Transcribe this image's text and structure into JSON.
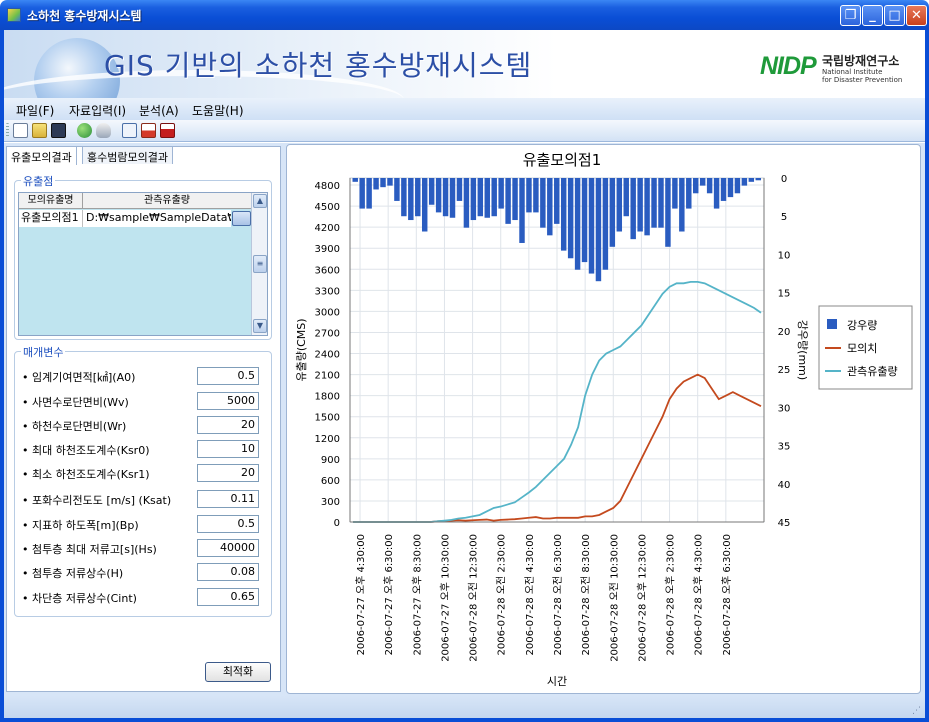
{
  "window": {
    "title": "소하천 홍수방재시스템",
    "controls": [
      "restore",
      "minimize",
      "maximize",
      "close"
    ]
  },
  "banner": {
    "title": "GIS 기반의 소하천 홍수방재시스템",
    "logo_mark": "NIDP",
    "logo_name": "국립방재연구소",
    "logo_sub_1": "National Institute",
    "logo_sub_2": "for Disaster Prevention"
  },
  "menu": [
    "파일(F)",
    "자료입력(I)",
    "분석(A)",
    "도움말(H)"
  ],
  "toolbar_icons": [
    "new-file-icon",
    "open-folder-icon",
    "save-icon",
    "globe-icon",
    "cloud-icon",
    "document-icon",
    "report-icon",
    "pdf-icon"
  ],
  "tabs": [
    "유출모의결과",
    "홍수범람모의결과"
  ],
  "outlet_group": {
    "title": "유출점",
    "columns": [
      "모의유출명",
      "관측유출량"
    ],
    "rows": [
      {
        "name": "유출모의점1",
        "path": "D:₩sample₩SampleData₩"
      }
    ]
  },
  "params_group": {
    "title": "매개변수",
    "params": [
      {
        "label": "• 임계기여면적[㎢](A0)",
        "value": "0.5"
      },
      {
        "label": "• 사면수로단면비(Wv)",
        "value": "5000"
      },
      {
        "label": "• 하천수로단면비(Wr)",
        "value": "20"
      },
      {
        "label": "• 최대 하천조도계수(Ksr0)",
        "value": "10"
      },
      {
        "label": "• 최소 하천조도계수(Ksr1)",
        "value": "20"
      },
      {
        "label": "• 포화수리전도도 [m/s] (Ksat)",
        "value": "0.11"
      },
      {
        "label": "• 지표하 하도폭[m](Bp)",
        "value": "0.5"
      },
      {
        "label": "• 첨투층 최대 저류고[s](Hs)",
        "value": "40000"
      },
      {
        "label": "• 첨투층 저류상수(H)",
        "value": "0.08"
      },
      {
        "label": "• 차단층 저류상수(Cint)",
        "value": "0.65"
      }
    ],
    "optimize_label": "최적화"
  },
  "chart_data": {
    "type": "line",
    "title": "유출모의점1",
    "xlabel": "시간",
    "ylabel": "유출량(CMS)",
    "y2label": "강우량(mm)",
    "ylim": [
      0,
      4900
    ],
    "y2lim": [
      0,
      45
    ],
    "y2_inverted": true,
    "yticks": [
      0,
      300,
      600,
      900,
      1200,
      1500,
      1800,
      2100,
      2400,
      2700,
      3000,
      3300,
      3600,
      3900,
      4200,
      4500,
      4800
    ],
    "y2ticks": [
      0,
      5,
      10,
      15,
      20,
      25,
      30,
      35,
      40,
      45
    ],
    "xtick_labels": [
      "2006-07-27 오후 4:30:00",
      "2006-07-27 오후 6:30:00",
      "2006-07-27 오후 8:30:00",
      "2006-07-27 오후 10:30:00",
      "2006-07-28 오전 12:30:00",
      "2006-07-28 오전 2:30:00",
      "2006-07-28 오전 4:30:00",
      "2006-07-28 오전 6:30:00",
      "2006-07-28 오전 8:30:00",
      "2006-07-28 오전 10:30:00",
      "2006-07-28 오후 12:30:00",
      "2006-07-28 오후 2:30:00",
      "2006-07-28 오후 4:30:00",
      "2006-07-28 오후 6:30:00"
    ],
    "grid": true,
    "legend_position": "right",
    "series": [
      {
        "name": "강우량",
        "kind": "bar",
        "axis": "y2",
        "color": "#2a5cc0",
        "values": [
          0.5,
          4,
          4,
          1.5,
          1.2,
          1,
          3,
          5,
          5.5,
          5,
          7,
          3.5,
          4.5,
          5,
          5.2,
          3,
          6.5,
          5.5,
          5,
          5.2,
          5,
          4,
          6,
          5.5,
          8.5,
          4.5,
          4.5,
          6.5,
          7.5,
          6,
          9.5,
          10.5,
          12,
          11,
          12.5,
          13.5,
          12,
          9,
          7,
          5,
          8,
          7,
          7.5,
          6.5,
          6.5,
          9,
          4,
          7,
          4,
          2,
          1,
          2,
          4,
          3,
          2.5,
          2,
          1,
          0.5,
          0.3
        ]
      },
      {
        "name": "모의치",
        "kind": "line",
        "axis": "y",
        "color": "#c44a1e",
        "values": [
          0,
          0,
          0,
          0,
          0,
          0,
          0,
          0,
          0,
          0,
          0,
          0,
          10,
          15,
          20,
          25,
          20,
          25,
          30,
          35,
          20,
          30,
          35,
          40,
          50,
          60,
          70,
          50,
          50,
          60,
          60,
          60,
          60,
          80,
          80,
          100,
          150,
          200,
          300,
          500,
          700,
          900,
          1100,
          1300,
          1500,
          1750,
          1900,
          2000,
          2050,
          2100,
          2050,
          1900,
          1750,
          1800,
          1850,
          1800,
          1750,
          1700,
          1650
        ]
      },
      {
        "name": "관측유출량",
        "kind": "line",
        "axis": "y",
        "color": "#55b4c8",
        "values": [
          0,
          0,
          0,
          0,
          0,
          0,
          0,
          0,
          0,
          0,
          0,
          0,
          10,
          20,
          30,
          50,
          60,
          80,
          100,
          150,
          200,
          220,
          250,
          280,
          350,
          420,
          500,
          600,
          700,
          800,
          900,
          1100,
          1350,
          1800,
          2100,
          2300,
          2400,
          2450,
          2500,
          2600,
          2700,
          2800,
          2950,
          3100,
          3250,
          3350,
          3400,
          3400,
          3420,
          3420,
          3400,
          3350,
          3300,
          3250,
          3200,
          3150,
          3100,
          3050,
          2980
        ]
      }
    ]
  }
}
